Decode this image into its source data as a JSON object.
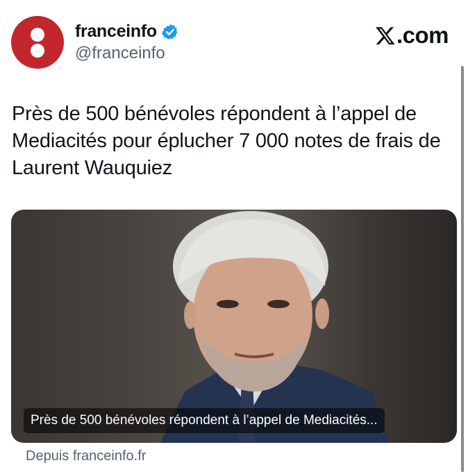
{
  "header": {
    "display_name": "franceinfo",
    "handle": "@franceinfo",
    "brand": ".com",
    "avatar_icon": "franceinfo-logo-icon",
    "verified_icon": "verified-badge-icon",
    "brand_icon": "x-logo-icon"
  },
  "tweet": {
    "text": "Près de 500 bénévoles répondent à l’appel de Mediacités pour éplucher 7 000 notes de frais de Laurent Wauquiez"
  },
  "card": {
    "caption": "Près de 500 bénévoles répondent à l’appel de Mediacités...",
    "image_subject": "portrait-photo"
  },
  "source": "Depuis franceinfo.fr",
  "colors": {
    "avatar_red": "#c1272d",
    "verified_blue": "#1d9bf0",
    "text": "#0f1419",
    "secondary_text": "#536471"
  }
}
